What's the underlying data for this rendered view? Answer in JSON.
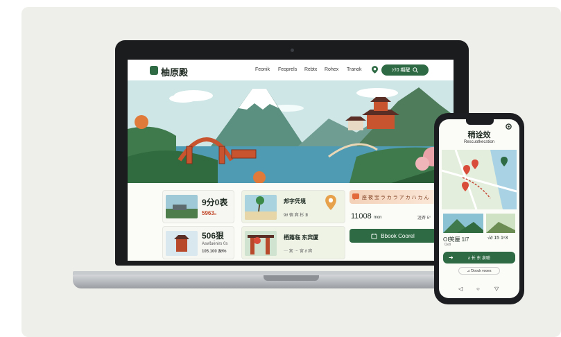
{
  "website": {
    "brand": "柚原殿",
    "nav": [
      "Feonik",
      "Feoprels",
      "Rebtx",
      "Rohex",
      "Tranok"
    ],
    "search_label": "ｼｸ0 期醒",
    "cards": {
      "card1_title": "9分0表",
      "card1_price": "5963₀",
      "card2_title": "506狠",
      "card2_line1": "Aswt̄ue̊nirs 0s",
      "card2_line2": "105.100 ∄∂%",
      "card3_title": "邦字凭境",
      "card3_sub": "9∂ 宿 宾 杉 ∄",
      "card4_title": "栖蕗临 东宾厦",
      "card4_sub": "⋯ 宮 ⋯ 宮 ∂ 宾",
      "card5_banner": "座 筱 宝 ラ カ ラ ア カ ハ カ ん",
      "card5_value": "11008",
      "card5_unit": "mon",
      "card5_tag": "涯斉 5°",
      "book_button": "Bbook Coorel"
    }
  },
  "phone_app": {
    "title": "稍诠效",
    "subtitle": "Rescuotkecstion",
    "caption_left": "OI笑厘 1l7",
    "caption_sub": "Ω≤ō",
    "caption_right": "√∂ 15 1ⁿ3",
    "primary_button": "ƨ 长 东 泉聪",
    "secondary_button": "⊿ Ɗoock vooes"
  },
  "colors": {
    "brand_green": "#2e6b44",
    "accent_orange": "#e26a3a",
    "accent_red": "#d94c3a"
  }
}
